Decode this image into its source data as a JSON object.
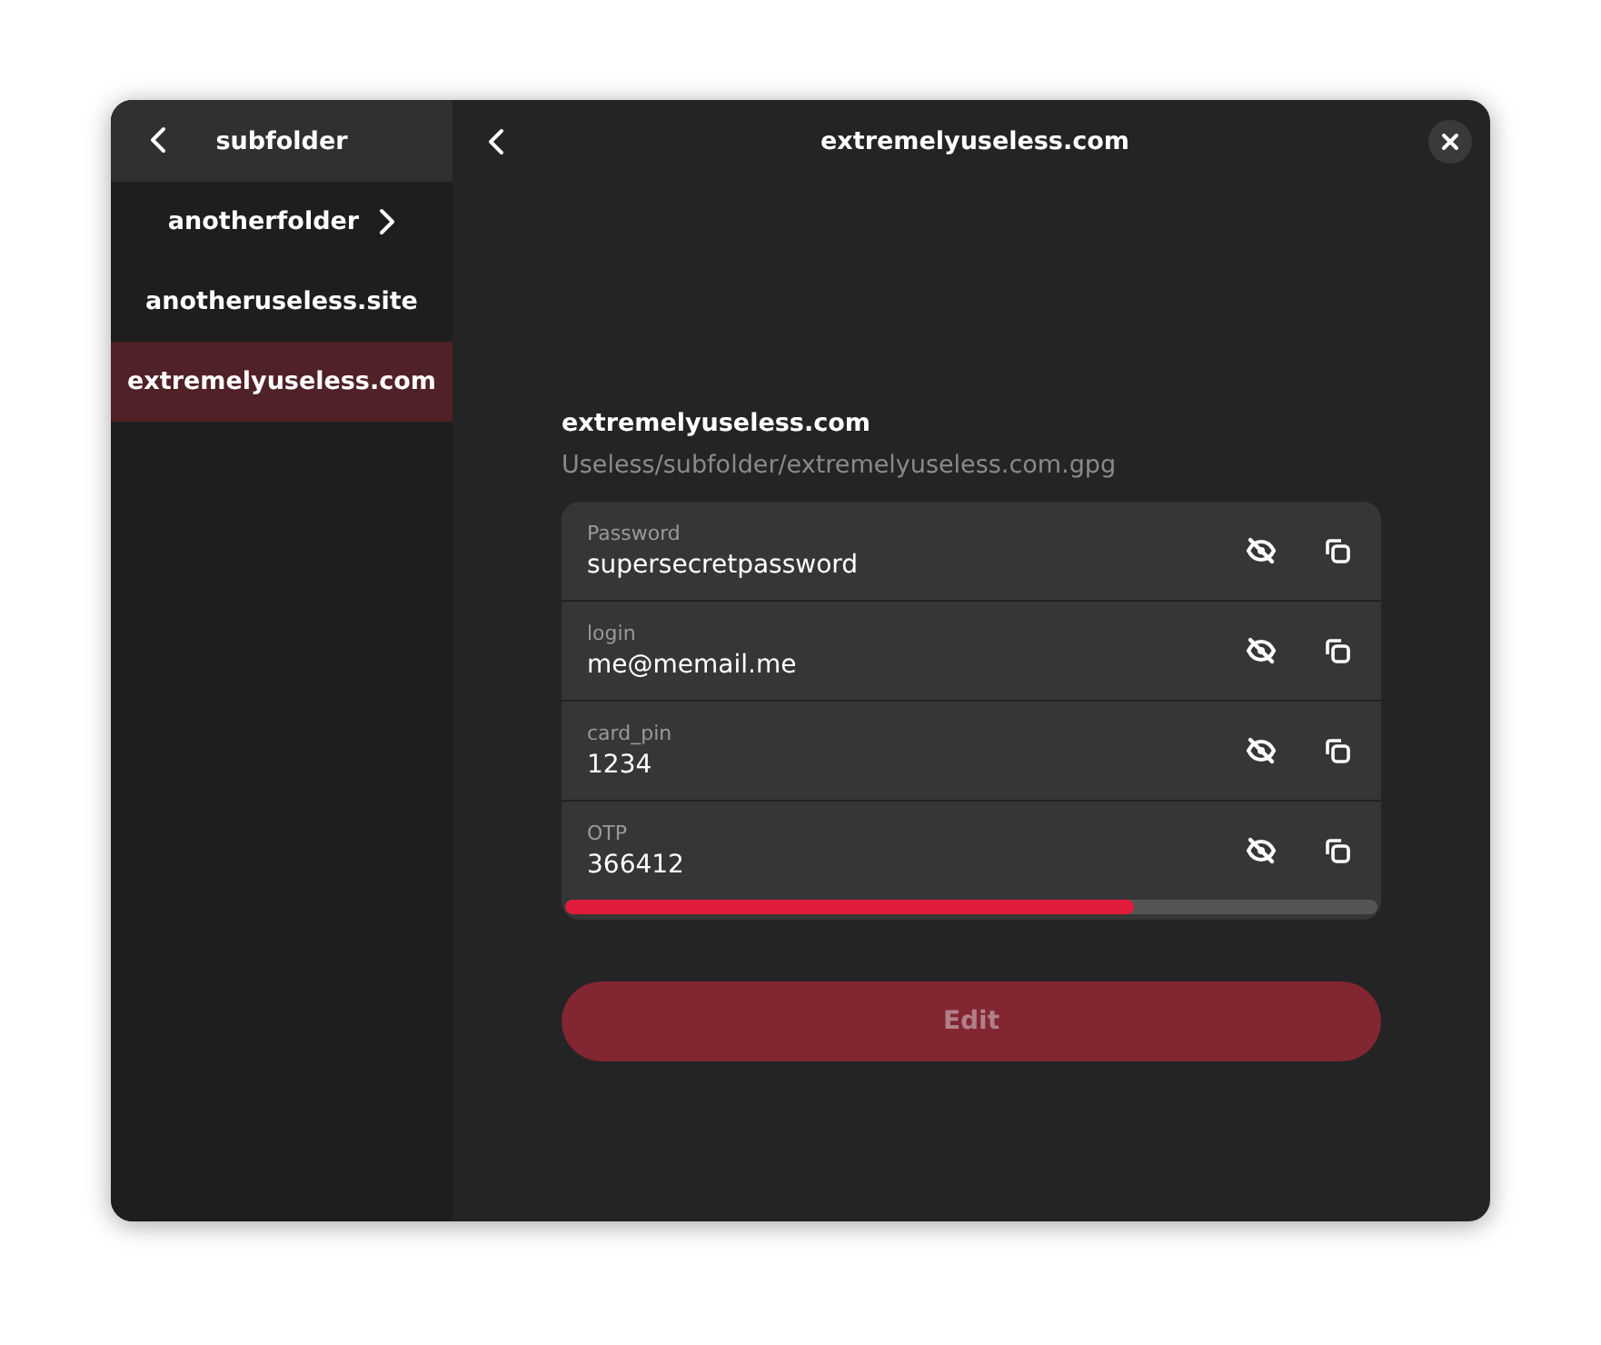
{
  "sidebar": {
    "title": "subfolder",
    "items": [
      {
        "label": "anotherfolder",
        "kind": "folder",
        "selected": false
      },
      {
        "label": "anotheruseless.site",
        "kind": "entry",
        "selected": false
      },
      {
        "label": "extremelyuseless.com",
        "kind": "entry",
        "selected": true
      }
    ]
  },
  "header": {
    "title": "extremelyuseless.com"
  },
  "entry": {
    "name": "extremelyuseless.com",
    "path": "Useless/subfolder/extremelyuseless.com.gpg",
    "fields": [
      {
        "label": "Password",
        "value": "supersecretpassword"
      },
      {
        "label": "login",
        "value": "me@memail.me"
      },
      {
        "label": "card_pin",
        "value": "1234"
      },
      {
        "label": "OTP",
        "value": "366412"
      }
    ],
    "otp_timer": {
      "level": 0.7
    },
    "edit_button": "Edit"
  }
}
